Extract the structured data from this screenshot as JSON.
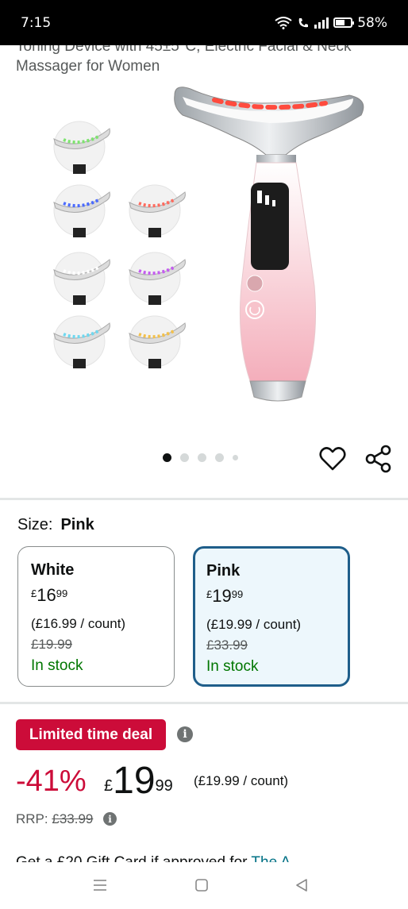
{
  "status_bar": {
    "time": "7:15",
    "battery": "58%"
  },
  "product": {
    "title_line1": "Toning Device with 45±5°C, Electric Facial & Neck",
    "title_line2": "Massager for Women"
  },
  "carousel": {
    "dot_count": 5,
    "active_index": 0
  },
  "size": {
    "label": "Size:",
    "selected": "Pink",
    "options": [
      {
        "name": "White",
        "currency": "£",
        "price_whole": "16",
        "price_fraction": "99",
        "unit_price": "(£16.99 / count)",
        "was_price": "£19.99",
        "stock": "In stock"
      },
      {
        "name": "Pink",
        "currency": "£",
        "price_whole": "19",
        "price_fraction": "99",
        "unit_price": "(£19.99 / count)",
        "was_price": "£33.99",
        "stock": "In stock"
      }
    ]
  },
  "deal": {
    "badge": "Limited time deal",
    "discount": "-41%",
    "currency": "£",
    "price_whole": "19",
    "price_fraction": "99",
    "unit_price": "(£19.99 / count)",
    "rrp_label": "RRP:",
    "rrp_value": "£33.99"
  },
  "gift_line": {
    "text": "Get a £20 Gift Card if approved for ",
    "link": "The A"
  },
  "colors": {
    "deal_red": "#cc0c39",
    "stock_green": "#007600",
    "selected_border": "#1f5e8a",
    "selected_bg": "#edf7fc",
    "link": "#007185"
  }
}
